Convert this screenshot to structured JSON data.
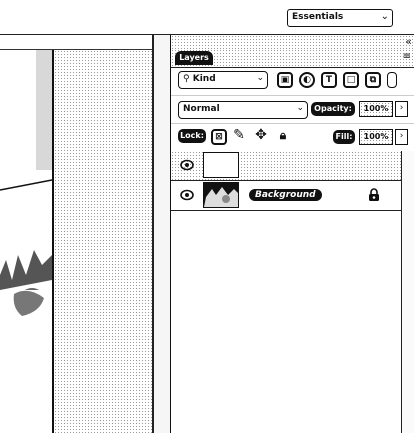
{
  "workspace": {
    "label": "Essentials"
  },
  "panel": {
    "tab_label": "Layers",
    "close_glyph": "«",
    "menu_glyph": "≡",
    "filter": {
      "kind_label": "Kind"
    },
    "blend_mode": "Normal",
    "opacity_label": "Opacity:",
    "opacity_value": "100%",
    "lock_label": "Lock:",
    "fill_label": "Fill:",
    "fill_value": "100%",
    "layers": [
      {
        "name": "",
        "visible": true,
        "thumbnail": "blank"
      },
      {
        "name": "Background",
        "visible": true,
        "thumbnail": "image",
        "locked": true
      }
    ]
  },
  "icons": {
    "filter_pixel": "image-icon",
    "filter_adjust": "circle-half-icon",
    "filter_type": "type-icon",
    "filter_shape": "shape-icon",
    "filter_smart": "smart-object-icon",
    "lock_transparent": "checker-lock-icon",
    "lock_brush": "brush-icon",
    "lock_move": "move-icon",
    "lock_all": "padlock-icon"
  }
}
